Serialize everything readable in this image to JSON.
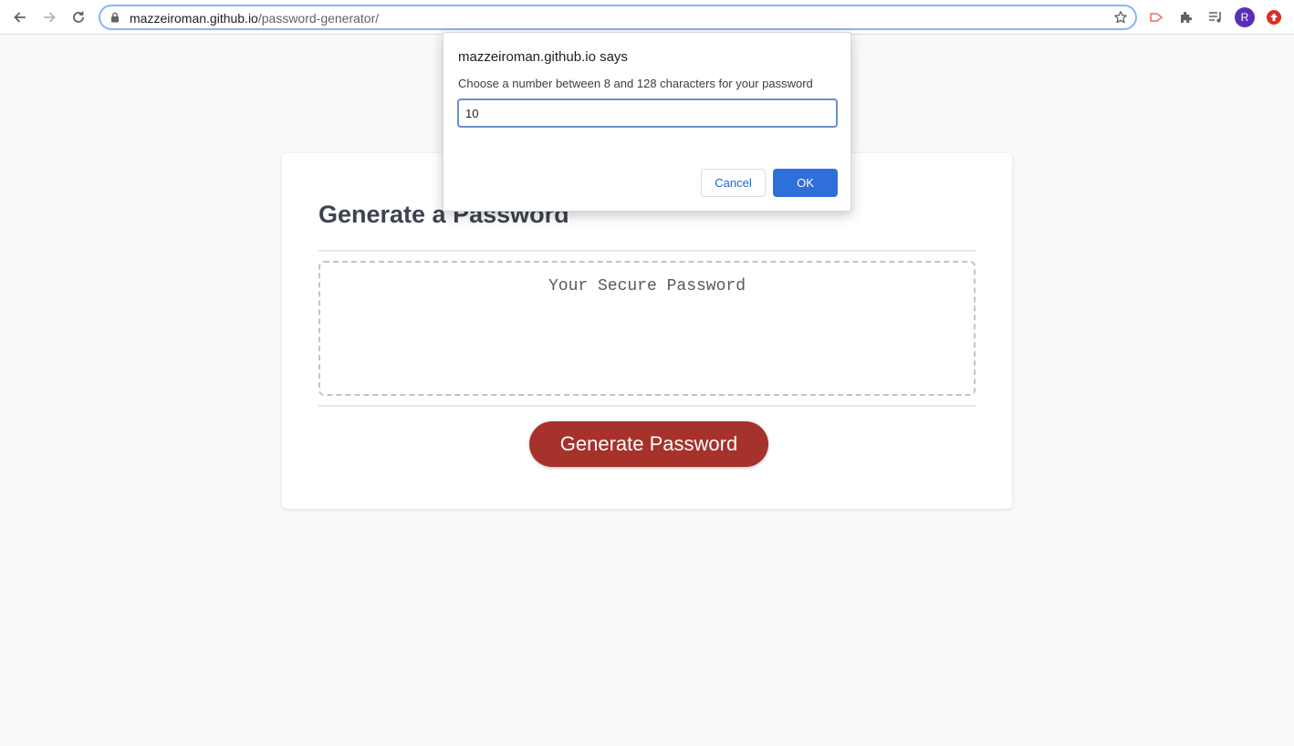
{
  "browser": {
    "url_host": "mazzeiroman.github.io",
    "url_path": "/password-generator/",
    "profile_initial": "R",
    "icons": [
      "back-arrow-icon",
      "forward-arrow-icon",
      "reload-icon",
      "lock-icon",
      "star-icon",
      "extension-arrow-icon",
      "puzzle-icon",
      "media-queue-icon",
      "profile-avatar",
      "red-extension-icon"
    ],
    "colors": {
      "omnibox_focus": "#8ab4f8",
      "profile": "#5b2fb5",
      "red_extension": "#d93025"
    }
  },
  "page": {
    "title": "Generate a Password",
    "password_placeholder": "Your Secure Password",
    "generate_button": "Generate Password",
    "colors": {
      "button_bg": "#a6322b",
      "title": "#3c4450",
      "background": "#f9fafb"
    }
  },
  "dialog": {
    "title": "mazzeiroman.github.io says",
    "message": "Choose a number between 8 and 128 characters for your password",
    "input_value": "10",
    "cancel_label": "Cancel",
    "ok_label": "OK",
    "colors": {
      "ok_bg": "#2f6fd9",
      "cancel_text": "#1a66d2"
    }
  }
}
